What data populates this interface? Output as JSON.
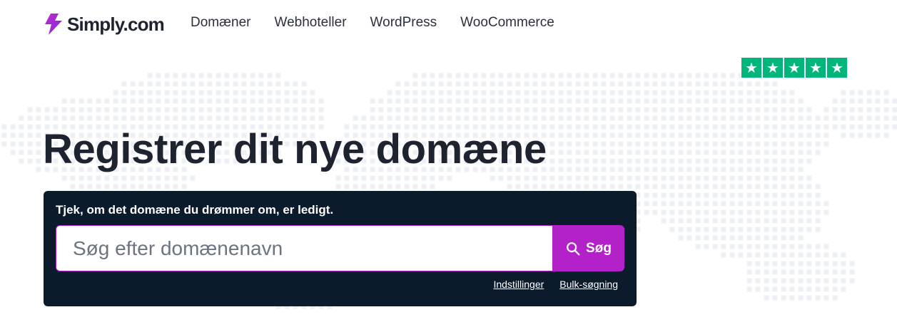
{
  "brand": {
    "name": "Simply.com",
    "accent_color": "#b321c9",
    "dark_color": "#0c1b2b",
    "rating_color": "#00b67a"
  },
  "nav": {
    "items": [
      "Domæner",
      "Webhoteller",
      "WordPress",
      "WooCommerce"
    ]
  },
  "rating": {
    "stars": 5,
    "max_stars": 5,
    "icon": "star-icon"
  },
  "hero": {
    "title": "Registrer dit nye domæne"
  },
  "search": {
    "heading": "Tjek, om det domæne du drømmer om, er ledigt.",
    "placeholder": "Søg efter domænenavn",
    "value": "",
    "button_label": "Søg",
    "button_icon": "search-icon",
    "links": [
      "Indstillinger",
      "Bulk-søgning"
    ]
  }
}
